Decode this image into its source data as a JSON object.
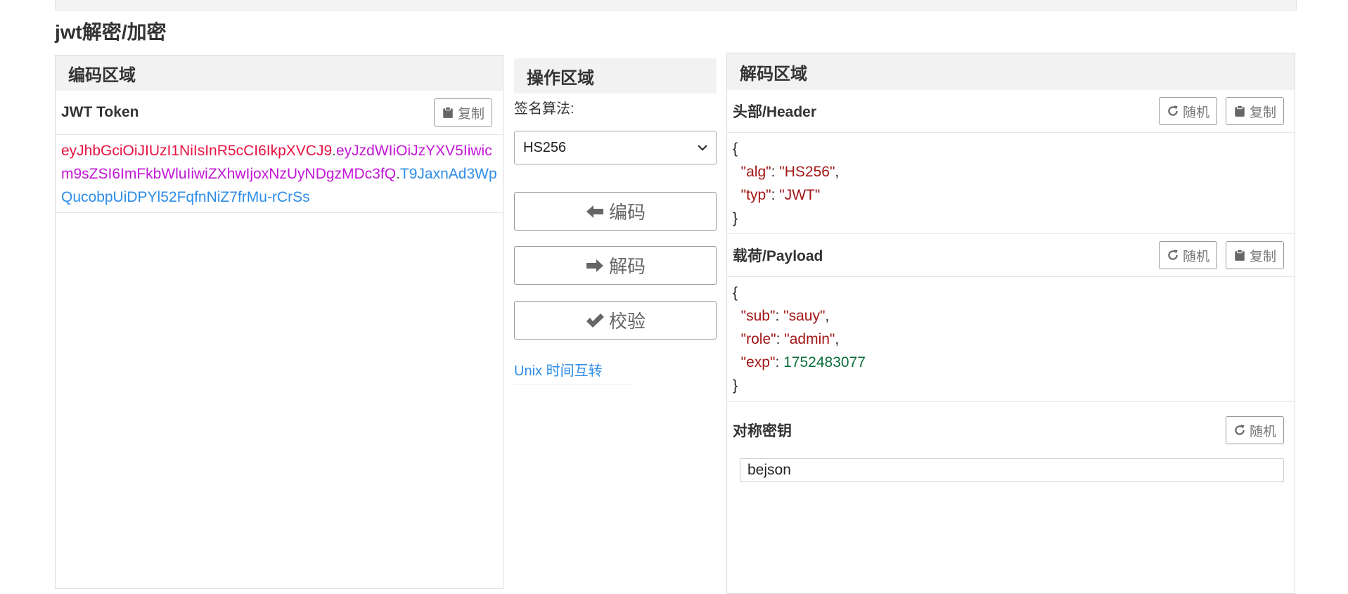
{
  "page": {
    "title": "jwt解密/加密"
  },
  "encode_panel": {
    "title": "编码区域",
    "token_label": "JWT Token",
    "copy_label": "复制",
    "token": {
      "header": "eyJhbGciOiJIUzI1NiIsInR5cCI6IkpXVCJ9",
      "payload": "eyJzdWIiOiJzYXV5Iiwicm9sZSI6ImFkbWluIiwiZXhwIjoxNzUyNDgzMDc3fQ",
      "signature": "T9JaxnAd3WpQucobpUiDPYl52FqfnNiZ7frMu-rCrSs",
      "dot": "."
    }
  },
  "operate_panel": {
    "title": "操作区域",
    "algo_label": "签名算法:",
    "algo_selected": "HS256",
    "encode_button": "编码",
    "decode_button": "解码",
    "verify_button": "校验",
    "unix_link": "Unix 时间互转"
  },
  "decode_panel": {
    "title": "解码区域",
    "header_label": "头部/Header",
    "payload_label": "载荷/Payload",
    "key_label": "对称密钥",
    "random_label": "随机",
    "copy_label": "复制",
    "header_json": {
      "open": "{",
      "close": "}",
      "alg_key": "\"alg\"",
      "alg_val": "\"HS256\"",
      "typ_key": "\"typ\"",
      "typ_val": "\"JWT\""
    },
    "payload_json": {
      "open": "{",
      "close": "}",
      "sub_key": "\"sub\"",
      "sub_val": "\"sauy\"",
      "role_key": "\"role\"",
      "role_val": "\"admin\"",
      "exp_key": "\"exp\"",
      "exp_val": "1752483077"
    },
    "secret_key": "bejson"
  },
  "icons": {
    "copy": "clipboard-icon",
    "random": "refresh-icon",
    "encode": "arrow-left-icon",
    "decode": "arrow-right-icon",
    "verify": "check-icon",
    "select": "chevron-down-icon"
  },
  "colors": {
    "token_header": "#e8103e",
    "token_payload": "#c215d6",
    "token_signature": "#2d8de8",
    "json_string": "#a31515",
    "json_number": "#0b6e3a",
    "link": "#2d8de8"
  }
}
